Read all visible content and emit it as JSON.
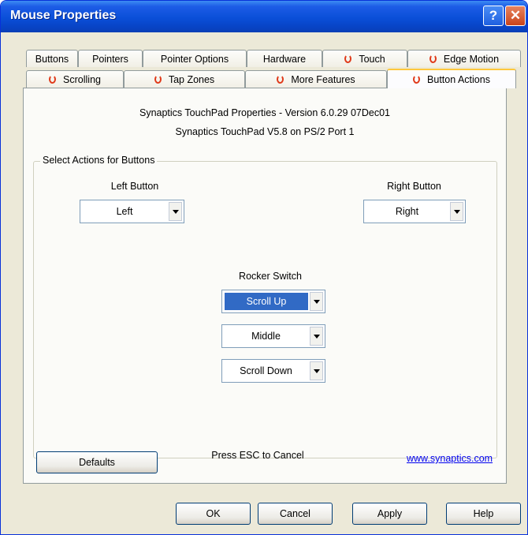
{
  "window": {
    "title": "Mouse Properties",
    "help_glyph": "?",
    "close_glyph": "✕"
  },
  "tabs_row1": [
    "Buttons",
    "Pointers",
    "Pointer Options",
    "Hardware",
    "Touch",
    "Edge Motion"
  ],
  "tabs_row2": [
    "Scrolling",
    "Tap Zones",
    "More Features",
    "Button Actions"
  ],
  "active_tab": "Button Actions",
  "panel": {
    "info_line1": "Synaptics TouchPad Properties - Version 6.0.29 07Dec01",
    "info_line2": "Synaptics TouchPad V5.8 on PS/2 Port 1",
    "group_label": "Select Actions for Buttons",
    "left_label": "Left Button",
    "left_value": "Left",
    "right_label": "Right Button",
    "right_value": "Right",
    "rocker_label": "Rocker Switch",
    "rocker_up": "Scroll Up",
    "rocker_middle": "Middle",
    "rocker_down": "Scroll Down",
    "defaults_button": "Defaults",
    "esc_text": "Press ESC to Cancel",
    "link": "www.synaptics.com"
  },
  "footer": {
    "ok": "OK",
    "cancel": "Cancel",
    "apply": "Apply",
    "help": "Help"
  },
  "colors": {
    "title_bar": "#0a4fd8",
    "selection": "#316ac5",
    "active_tab_accent": "#ffc83c",
    "synaptics_icon": "#e03a1a"
  }
}
